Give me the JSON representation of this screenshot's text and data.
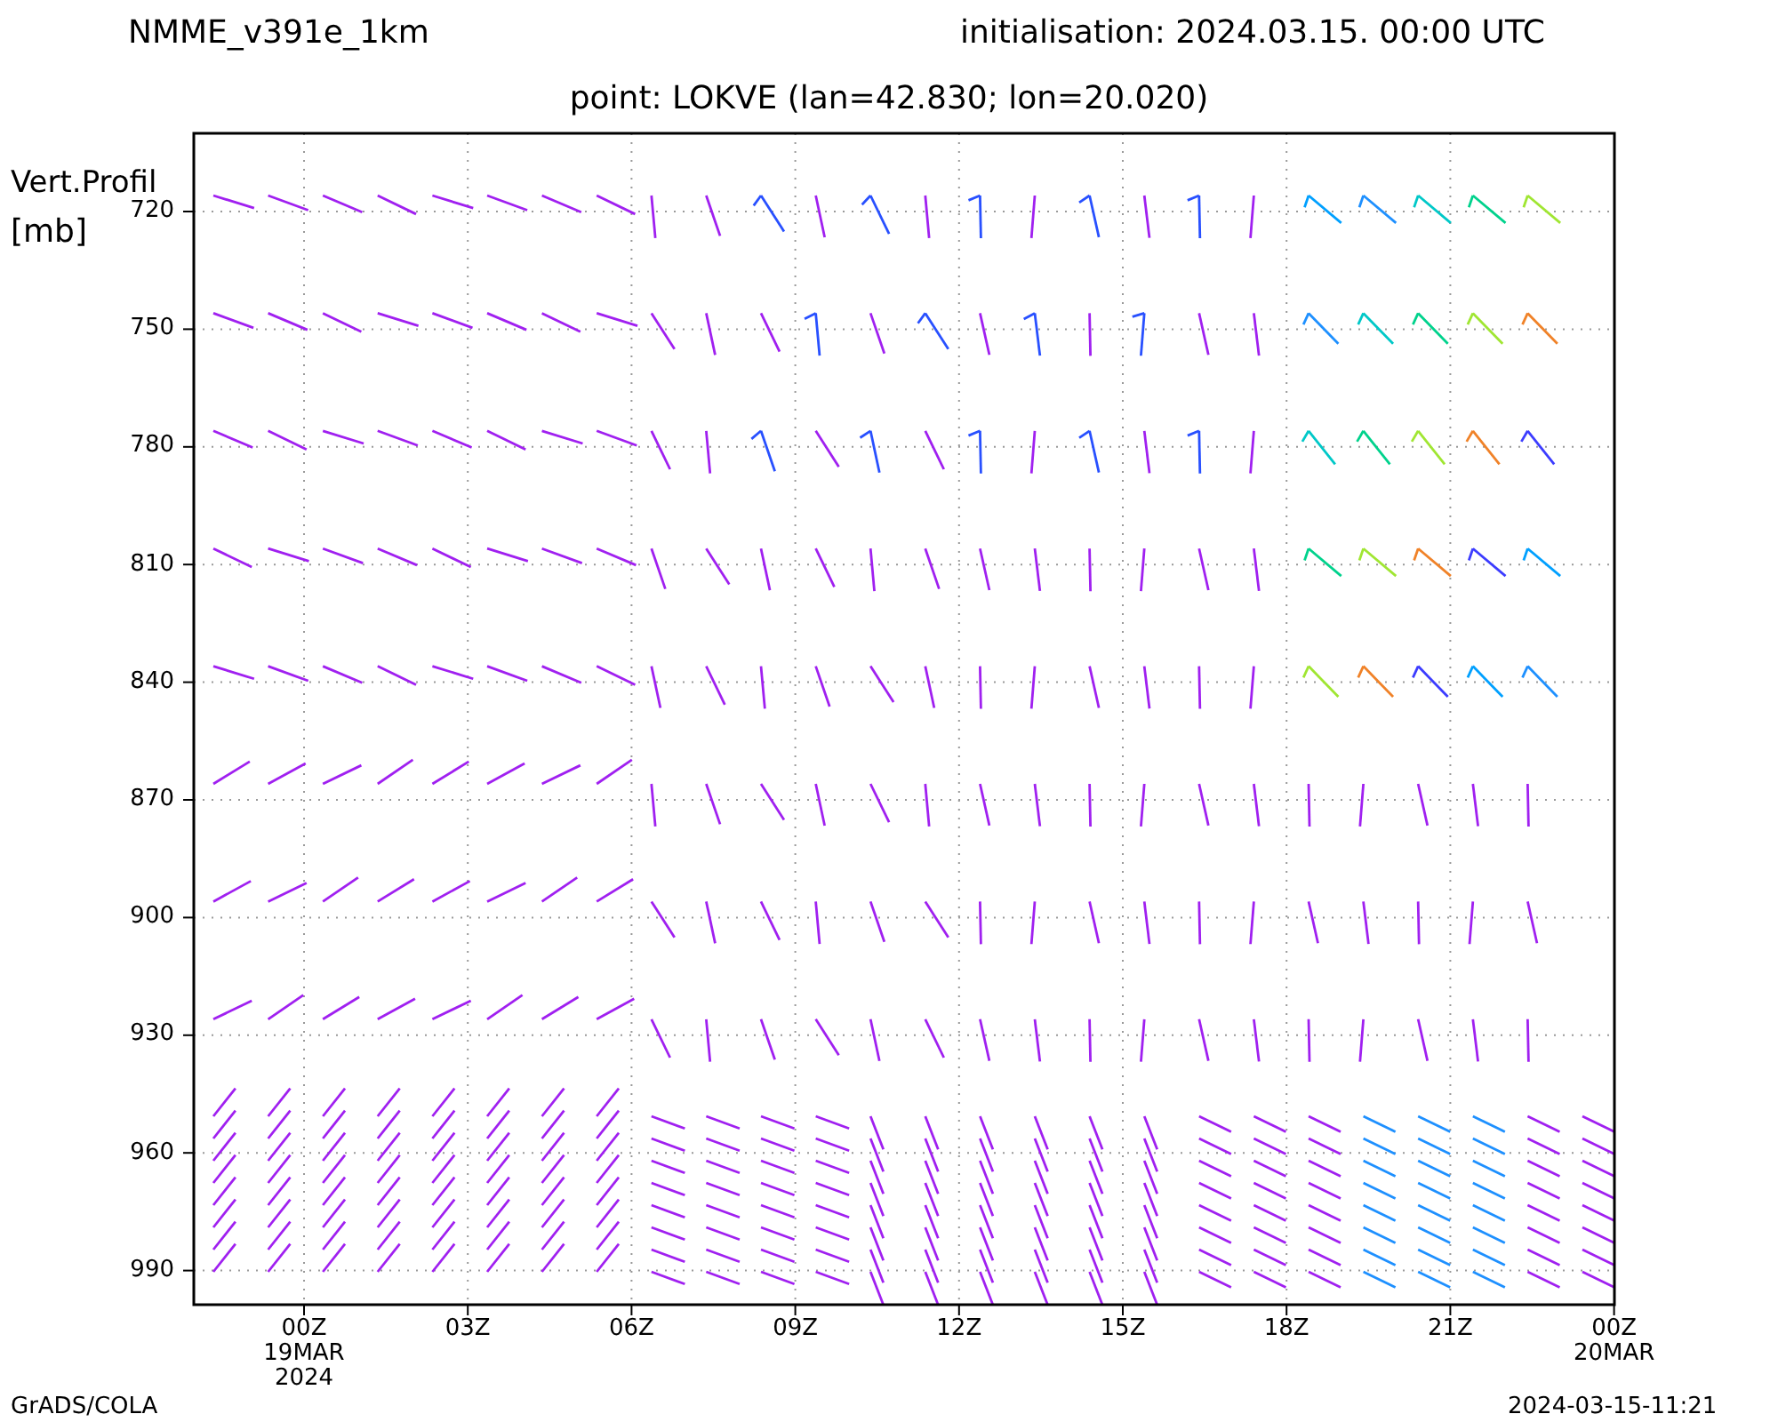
{
  "header": {
    "model": "NMME_v391e_1km",
    "initialisation": "initialisation: 2024.03.15. 00:00 UTC"
  },
  "chart": {
    "title": "point: LOKVE (lan=42.830; lon=20.020)",
    "ylabel": [
      "Vert.Profil",
      "[mb]"
    ],
    "yticks": [
      "720",
      "750",
      "780",
      "810",
      "840",
      "870",
      "900",
      "930",
      "960",
      "990"
    ],
    "xticks": [
      {
        "label": "00Z",
        "sub": [
          "19MAR",
          "2024"
        ]
      },
      {
        "label": "03Z"
      },
      {
        "label": "06Z"
      },
      {
        "label": "09Z"
      },
      {
        "label": "12Z"
      },
      {
        "label": "15Z"
      },
      {
        "label": "18Z"
      },
      {
        "label": "21Z"
      },
      {
        "label": "00Z",
        "sub": [
          "20MAR"
        ]
      }
    ]
  },
  "footer": {
    "left": "GrADS/COLA",
    "right": "2024-03-15-11:21"
  }
}
